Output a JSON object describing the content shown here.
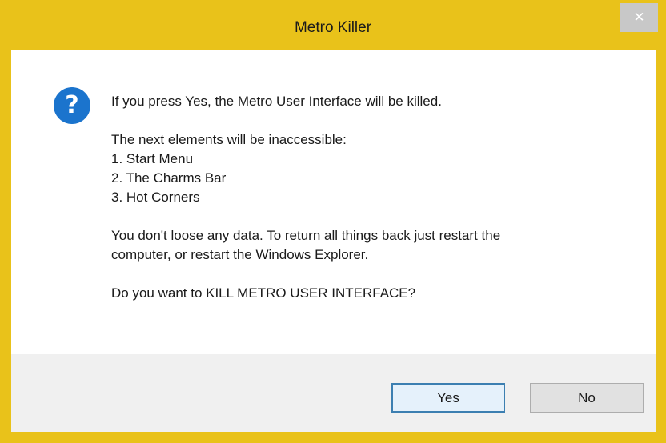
{
  "dialog": {
    "title": "Metro Killer",
    "close_glyph": "✕",
    "icon": "question-icon",
    "icon_glyph": "?",
    "accent_color": "#e9c21a",
    "message": {
      "line1": "If you press Yes, the Metro User Interface will be killed.",
      "line2": "The next elements will be inaccessible:",
      "items": [
        "1. Start Menu",
        "2. The Charms Bar",
        "3. Hot Corners"
      ],
      "line3a": "You don't loose any data. To return all things back just restart the",
      "line3b": "computer, or restart the Windows Explorer.",
      "line4": "Do you want to KILL METRO USER INTERFACE?"
    },
    "buttons": {
      "yes_label": "Yes",
      "no_label": "No"
    }
  }
}
